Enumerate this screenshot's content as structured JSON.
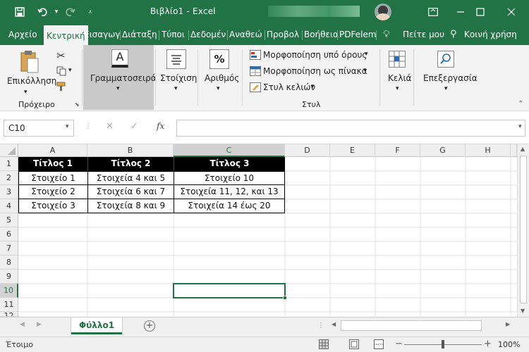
{
  "window": {
    "title": "Βιβλίο1 - Excel",
    "colors": {
      "brand": "#217346",
      "ribbon_bg": "#f3f3f3",
      "header_cell_bg": "#000000"
    }
  },
  "titlebar_icons": [
    "save-icon",
    "undo-icon",
    "redo-icon",
    "customize-qat-icon",
    "ribbon-display-icon",
    "minimize-icon",
    "maximize-icon",
    "close-icon"
  ],
  "tabs": [
    "Αρχείο",
    "Κεντρική",
    "Εισαγωγ",
    "Διάταξη",
    "Τύποι",
    "Δεδομέν",
    "Αναθεώ",
    "Προβολ",
    "Βοήθεια",
    "PDFelem"
  ],
  "active_tab": "Κεντρική",
  "tell_me": "Πείτε μου",
  "share": "Κοινή χρήση",
  "ribbon": {
    "paste": "Επικόλληση",
    "clipboard_group": "Πρόχειρο",
    "font": "Γραμματοσειρά",
    "alignment": "Στοίχιση",
    "number": "Αριθμός",
    "number_icon_glyph": "%",
    "font_icon_glyph": "A",
    "styles_items": [
      "Μορφοποίηση υπό όρους",
      "Μορφοποίηση ως πίνακα",
      "Στυλ κελιών"
    ],
    "styles_group": "Στυλ",
    "cells": "Κελιά",
    "editing": "Επεξεργασία"
  },
  "formula_bar": {
    "name_box": "C10",
    "fx_label": "fx",
    "value": ""
  },
  "columns": [
    "A",
    "B",
    "C",
    "D",
    "E",
    "F",
    "G",
    "H"
  ],
  "rows": [
    "1",
    "2",
    "3",
    "4",
    "5",
    "6",
    "7",
    "8",
    "9",
    "10",
    "11",
    "12"
  ],
  "table": {
    "headers": [
      "Τίτλος 1",
      "Τίτλος 2",
      "Τίτλος 3"
    ],
    "rows": [
      [
        "Στοιχείο 1",
        "Στοιχεία 4 και 5",
        "Στοιχείο 10"
      ],
      [
        "Στοιχείο 2",
        "Στοιχεία 6 και 7",
        "Στοιχεία 11, 12, και 13"
      ],
      [
        "Στοιχείο 3",
        "Στοιχεία 8 και 9",
        "Στοιχεία 14 έως 20"
      ]
    ]
  },
  "selected_cell": "C10",
  "sheet": {
    "name": "Φύλλο1"
  },
  "status": {
    "ready": "Έτοιμο",
    "zoom": "100%",
    "zoom_minus": "−",
    "zoom_plus": "+"
  }
}
